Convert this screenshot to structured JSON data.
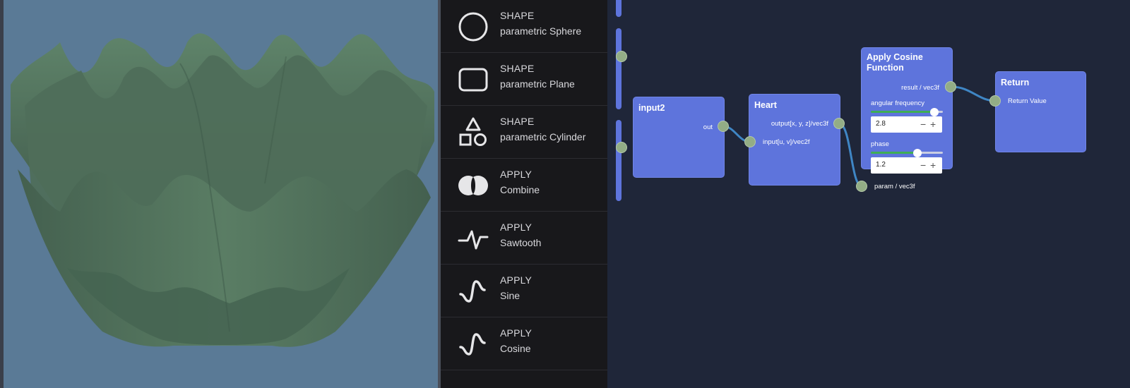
{
  "library": {
    "items": [
      {
        "category": "SHAPE",
        "name": "parametric Sphere",
        "icon": "circle-icon"
      },
      {
        "category": "SHAPE",
        "name": "parametric Plane",
        "icon": "rounded-rect-icon"
      },
      {
        "category": "SHAPE",
        "name": "parametric Cylinder",
        "icon": "shapes-icon"
      },
      {
        "category": "APPLY",
        "name": "Combine",
        "icon": "combine-icon"
      },
      {
        "category": "APPLY",
        "name": "Sawtooth",
        "icon": "sawtooth-icon"
      },
      {
        "category": "APPLY",
        "name": "Sine",
        "icon": "sine-icon"
      },
      {
        "category": "APPLY",
        "name": "Cosine",
        "icon": "cosine-icon"
      }
    ]
  },
  "graph": {
    "nodes": {
      "input2": {
        "title": "input2",
        "out_label": "out"
      },
      "heart": {
        "title": "Heart",
        "output_label": "output[x, y, z]/vec3f",
        "input_label": "input[u, v]/vec2f"
      },
      "cosine": {
        "title_line1": "Apply Cosine",
        "title_line2": "Function",
        "result_label": "result / vec3f",
        "param_label": "param / vec3f",
        "angular_frequency": {
          "label": "angular frequency",
          "value": "2.8",
          "slider_fraction": 0.75
        },
        "phase": {
          "label": "phase",
          "value": "1.2",
          "slider_fraction": 0.65
        }
      },
      "return": {
        "title": "Return",
        "input_label": "Return Value"
      }
    }
  },
  "colors": {
    "viewport_bg": "#5a7a96",
    "surface": "#4d6b58",
    "node_bg": "#5e74dc",
    "port": "#93ad86",
    "wire": "#3f86c5",
    "slider_active": "#3fae55"
  }
}
